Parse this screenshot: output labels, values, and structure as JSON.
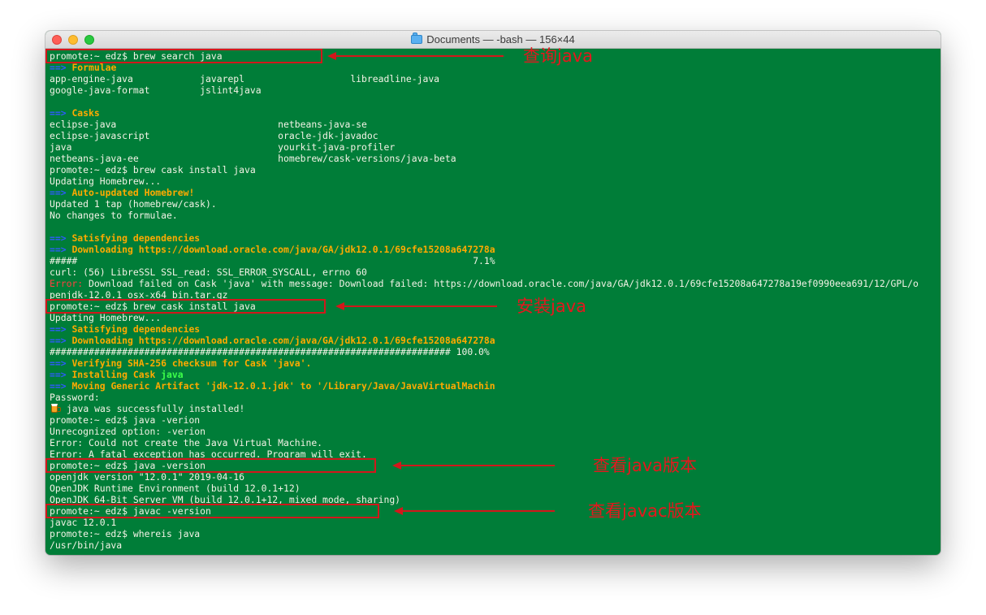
{
  "window": {
    "title": "Documents — -bash — 156×44",
    "background": "#007d38"
  },
  "icons": {
    "window_title_icon": "folder-icon",
    "installed_icon": "beer-mug-icon"
  },
  "terminal_lines": [
    [
      {
        "t": "promote:~ edz$ brew search java"
      }
    ],
    [
      {
        "t": "==>",
        "c": "arrow"
      },
      {
        "t": " "
      },
      {
        "t": "Formulae",
        "c": "head"
      }
    ],
    [
      {
        "t": "app-engine-java            javarepl                   libreadline-java"
      }
    ],
    [
      {
        "t": "google-java-format         jslint4java"
      }
    ],
    [
      {
        "t": ""
      }
    ],
    [
      {
        "t": "==>",
        "c": "arrow"
      },
      {
        "t": " "
      },
      {
        "t": "Casks",
        "c": "head"
      }
    ],
    [
      {
        "t": "eclipse-java                             netbeans-java-se"
      }
    ],
    [
      {
        "t": "eclipse-javascript                       oracle-jdk-javadoc"
      }
    ],
    [
      {
        "t": "java                                     yourkit-java-profiler"
      }
    ],
    [
      {
        "t": "netbeans-java-ee                         homebrew/cask-versions/java-beta"
      }
    ],
    [
      {
        "t": "promote:~ edz$ brew cask install java"
      }
    ],
    [
      {
        "t": "Updating Homebrew..."
      }
    ],
    [
      {
        "t": "==>",
        "c": "arrow"
      },
      {
        "t": " "
      },
      {
        "t": "Auto-updated Homebrew!",
        "c": "head"
      }
    ],
    [
      {
        "t": "Updated 1 tap (homebrew/cask)."
      }
    ],
    [
      {
        "t": "No changes to formulae."
      }
    ],
    [
      {
        "t": ""
      }
    ],
    [
      {
        "t": "==>",
        "c": "arrow"
      },
      {
        "t": " "
      },
      {
        "t": "Satisfying dependencies",
        "c": "head"
      }
    ],
    [
      {
        "t": "==>",
        "c": "arrow"
      },
      {
        "t": " "
      },
      {
        "t": "Downloading https://download.oracle.com/java/GA/jdk12.0.1/69cfe15208a647278a",
        "c": "head"
      }
    ],
    [
      {
        "t": "#####                                                                       7.1%"
      }
    ],
    [
      {
        "t": "curl: (56) LibreSSL SSL_read: SSL_ERROR_SYSCALL, errno 60"
      }
    ],
    [
      {
        "t": "Error:",
        "c": "err"
      },
      {
        "t": " Download failed on Cask 'java' with message: Download failed: https://download.oracle.com/java/GA/jdk12.0.1/69cfe15208a647278a19ef0990eea691/12/GPL/o"
      }
    ],
    [
      {
        "t": "penjdk-12.0.1 osx-x64 bin.tar.gz"
      }
    ],
    [
      {
        "t": "promote:~ edz$ brew cask install java"
      }
    ],
    [
      {
        "t": "Updating Homebrew..."
      }
    ],
    [
      {
        "t": "==>",
        "c": "arrow"
      },
      {
        "t": " "
      },
      {
        "t": "Satisfying dependencies",
        "c": "head"
      }
    ],
    [
      {
        "t": "==>",
        "c": "arrow"
      },
      {
        "t": " "
      },
      {
        "t": "Downloading https://download.oracle.com/java/GA/jdk12.0.1/69cfe15208a647278a",
        "c": "head"
      }
    ],
    [
      {
        "t": "######################################################################## 100.0%"
      }
    ],
    [
      {
        "t": "==>",
        "c": "arrow"
      },
      {
        "t": " "
      },
      {
        "t": "Verifying SHA-256 checksum for Cask 'java'.",
        "c": "head"
      }
    ],
    [
      {
        "t": "==>",
        "c": "arrow"
      },
      {
        "t": " "
      },
      {
        "t": "Installing Cask ",
        "c": "head"
      },
      {
        "t": "java",
        "c": "green"
      }
    ],
    [
      {
        "t": "==>",
        "c": "arrow"
      },
      {
        "t": " "
      },
      {
        "t": "Moving Generic Artifact 'jdk-12.0.1.jdk' to '/Library/Java/JavaVirtualMachin",
        "c": "head"
      }
    ],
    [
      {
        "t": "Password:"
      }
    ],
    [
      {
        "i": "beer"
      },
      {
        "t": " java was successfully installed!"
      }
    ],
    [
      {
        "t": "promote:~ edz$ java -verion"
      }
    ],
    [
      {
        "t": "Unrecognized option: -verion"
      }
    ],
    [
      {
        "t": "Error: Could not create the Java Virtual Machine."
      }
    ],
    [
      {
        "t": "Error: A fatal exception has occurred. Program will exit."
      }
    ],
    [
      {
        "t": "promote:~ edz$ java -version"
      }
    ],
    [
      {
        "t": "openjdk version \"12.0.1\" 2019-04-16"
      }
    ],
    [
      {
        "t": "OpenJDK Runtime Environment (build 12.0.1+12)"
      }
    ],
    [
      {
        "t": "OpenJDK 64-Bit Server VM (build 12.0.1+12, mixed mode, sharing)"
      }
    ],
    [
      {
        "t": "promote:~ edz$ javac -version"
      }
    ],
    [
      {
        "t": "javac 12.0.1"
      }
    ],
    [
      {
        "t": "promote:~ edz$ whereis java"
      }
    ],
    [
      {
        "t": "/usr/bin/java"
      }
    ]
  ],
  "annotations": [
    {
      "name": "search",
      "line": 0,
      "label": "查询java"
    },
    {
      "name": "install",
      "line": 22,
      "label": "安装java"
    },
    {
      "name": "java-version",
      "line": 36,
      "label": "查看java版本"
    },
    {
      "name": "javac-version",
      "line": 40,
      "label": "查看javac版本"
    }
  ],
  "colors": {
    "prompt_text": "#f3f3e6",
    "arrow": "#2f5bff",
    "heading": "#ffaa00",
    "error": "#ff4040",
    "highlight": "#d3171b"
  }
}
